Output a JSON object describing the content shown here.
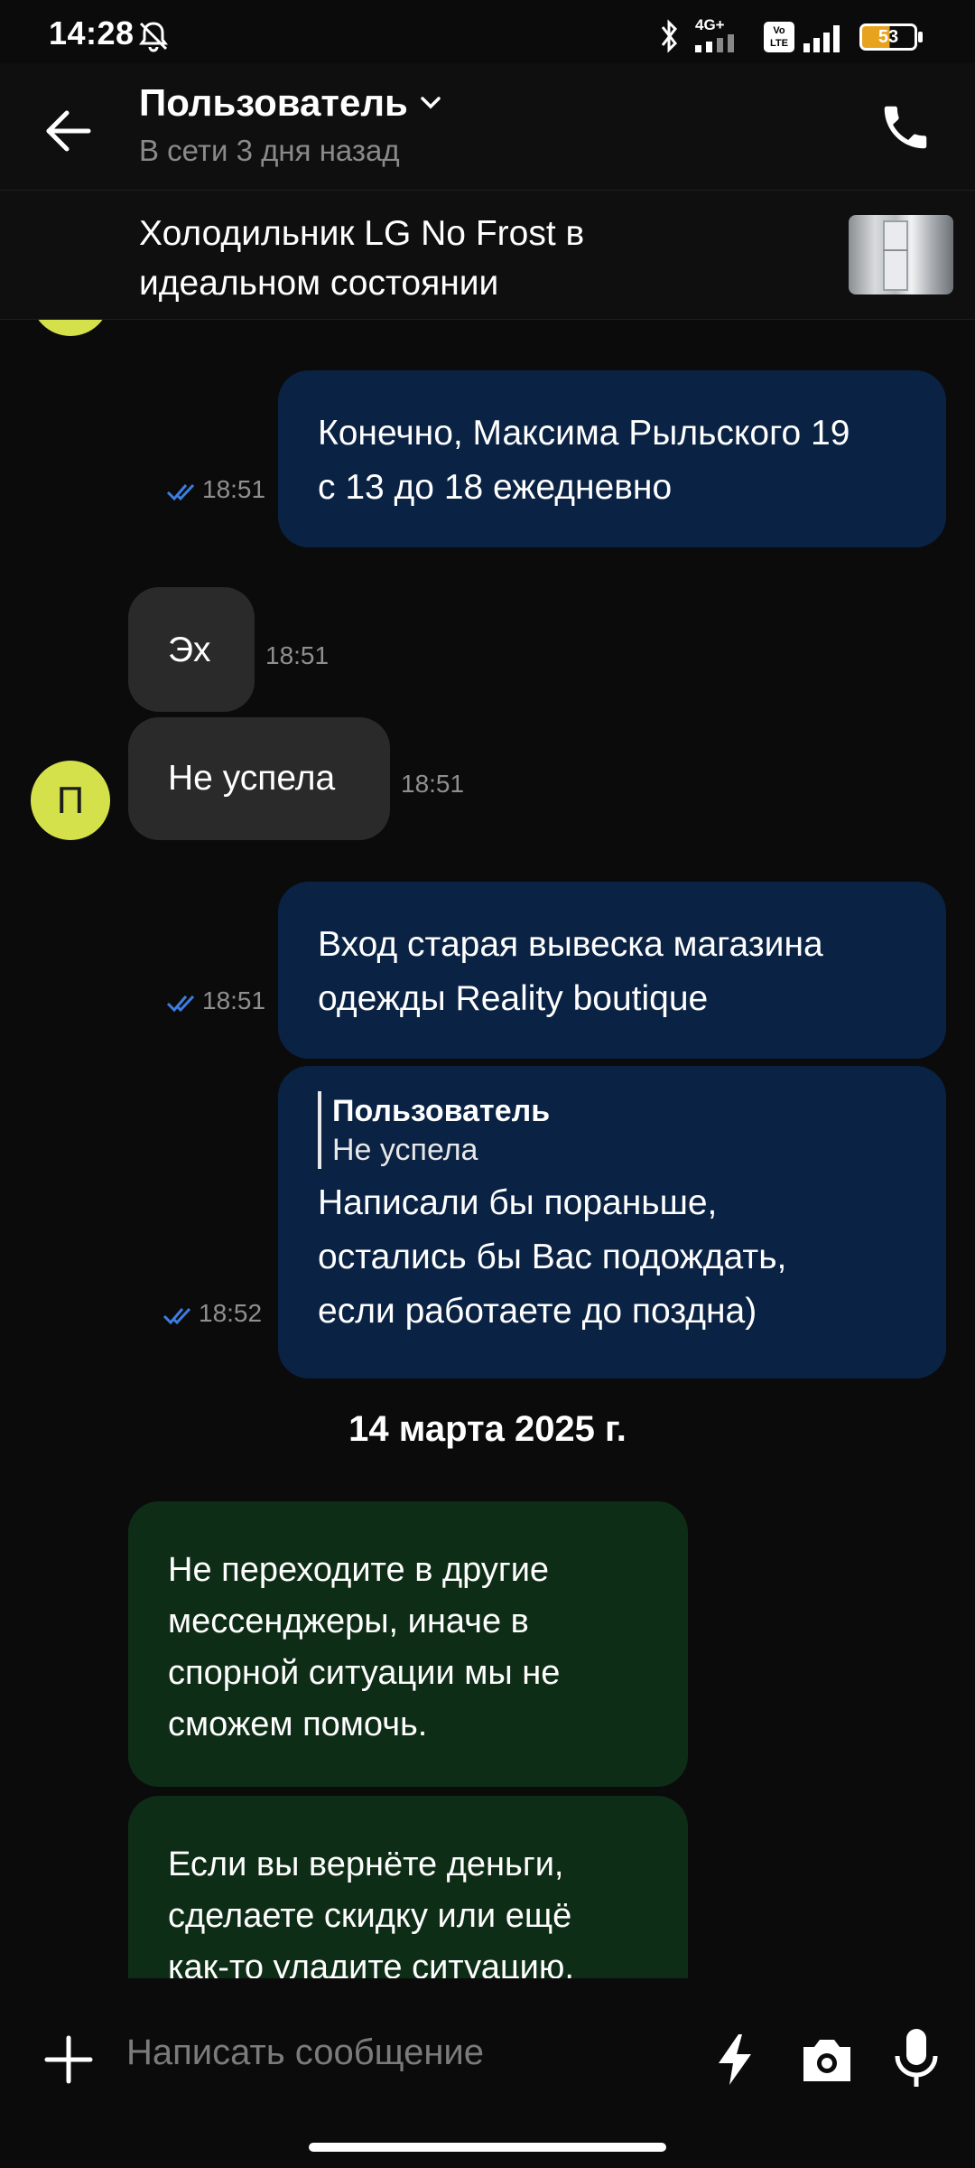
{
  "status_bar": {
    "time": "14:28",
    "network": "4G+",
    "volte": "Vo LTE",
    "battery": "53"
  },
  "header": {
    "title": "Пользователь",
    "subtitle": "В сети 3 дня назад"
  },
  "listing": {
    "title": "Холодильник LG No Frost в идеальном состоянии"
  },
  "avatar_initial": "П",
  "messages": [
    {
      "dir": "out",
      "text_lines": [
        "Конечно, Максима Рыльского 19",
        "с 13 до 18 ежедневно"
      ],
      "time": "18:51"
    },
    {
      "dir": "in",
      "text": "Эх",
      "time": "18:51"
    },
    {
      "dir": "in",
      "text": "Не успела",
      "time": "18:51"
    },
    {
      "dir": "out",
      "text_lines": [
        "Вход старая вывеска магазина",
        "одежды Reality boutique"
      ],
      "time": "18:51"
    },
    {
      "dir": "out",
      "quote_author": "Пользователь",
      "quote_text": "Не успела",
      "text_lines": [
        "Написали бы пораньше,",
        "остались бы Вас подождать,",
        "если работаете до поздна)"
      ],
      "time": "18:52"
    }
  ],
  "date_separator": "14 марта 2025 г.",
  "system_messages": [
    {
      "text_lines": [
        "Не переходите в другие",
        "мессенджеры, иначе в",
        "спорной ситуации мы не",
        "сможем помочь."
      ]
    },
    {
      "text_lines": [
        "Если вы вернёте деньги,",
        "сделаете скидку или ещё",
        "как-то уладите ситуацию,"
      ]
    }
  ],
  "input": {
    "placeholder": "Написать сообщение"
  },
  "colors": {
    "outgoing_bubble": "#0a2244",
    "incoming_bubble": "#2a2a2a",
    "system_bubble": "#0e2d16",
    "avatar": "#d4e14a",
    "read_check": "#3d7de0"
  }
}
